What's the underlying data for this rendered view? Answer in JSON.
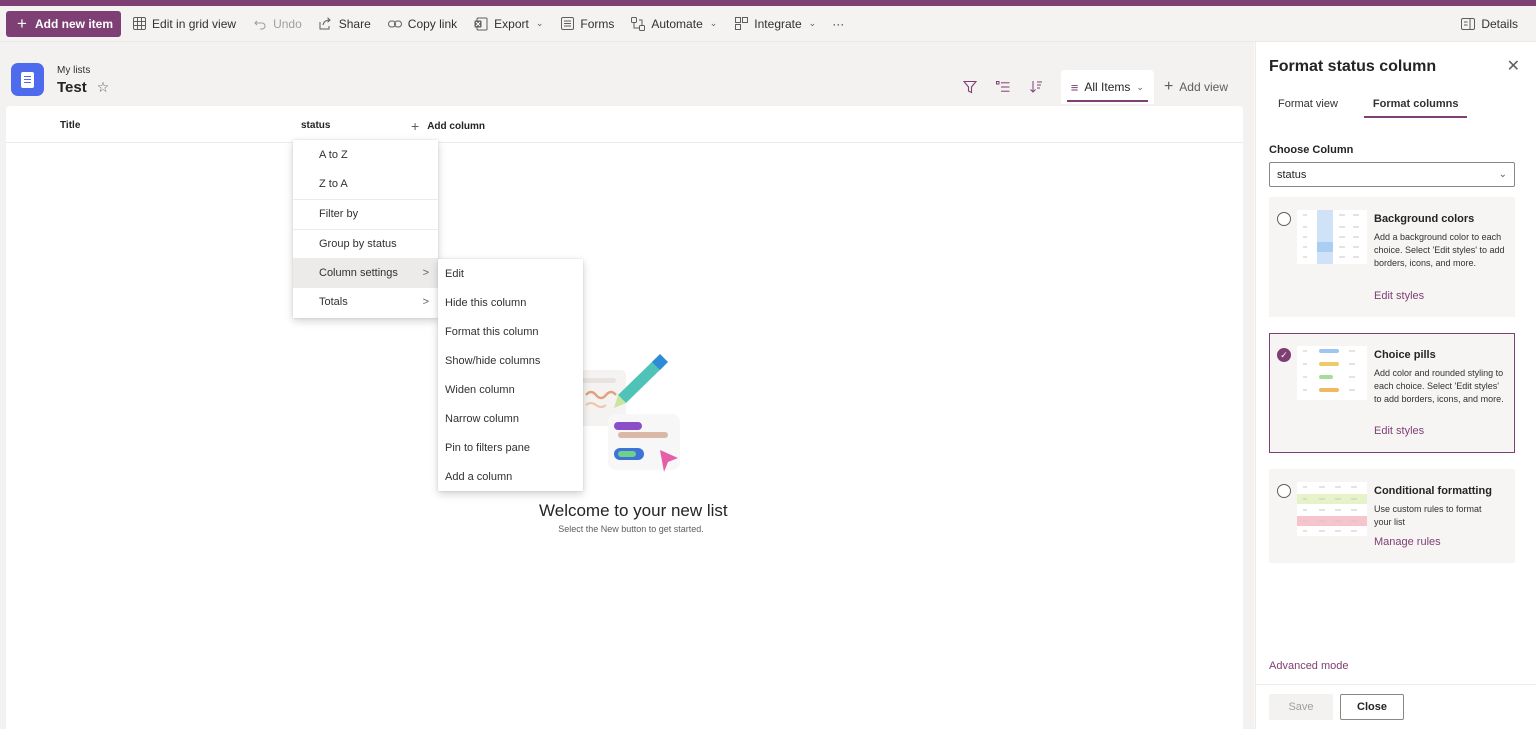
{
  "toolbar": {
    "add_new_item": "Add new item",
    "edit_grid": "Edit in grid view",
    "undo": "Undo",
    "share": "Share",
    "copy_link": "Copy link",
    "export": "Export",
    "forms": "Forms",
    "automate": "Automate",
    "integrate": "Integrate",
    "more": "···",
    "details": "Details"
  },
  "header": {
    "breadcrumb": "My lists",
    "list_title": "Test",
    "star": "☆",
    "view_name": "All Items",
    "add_view": "Add view"
  },
  "columns": {
    "title": "Title",
    "status": "status",
    "add_column": "Add column"
  },
  "empty_state": {
    "title": "Welcome to your new list",
    "subtitle": "Select the New button to get started."
  },
  "column_menu": {
    "items": [
      {
        "label": "A to Z"
      },
      {
        "label": "Z to A"
      },
      {
        "label": "Filter by"
      },
      {
        "label": "Group by status"
      },
      {
        "label": "Column settings",
        "has_submenu": true,
        "active": true
      },
      {
        "label": "Totals",
        "has_submenu": true
      }
    ]
  },
  "settings_submenu": {
    "items": [
      {
        "label": "Edit"
      },
      {
        "label": "Hide this column"
      },
      {
        "label": "Format this column"
      },
      {
        "label": "Show/hide columns"
      },
      {
        "label": "Widen column"
      },
      {
        "label": "Narrow column"
      },
      {
        "label": "Pin to filters pane"
      },
      {
        "label": "Add a column"
      }
    ]
  },
  "panel": {
    "title": "Format status column",
    "tabs": [
      {
        "label": "Format view",
        "active": false
      },
      {
        "label": "Format columns",
        "active": true
      }
    ],
    "choose_column_label": "Choose Column",
    "selected_column": "status",
    "options": [
      {
        "title": "Background colors",
        "desc": "Add a background color to each choice. Select 'Edit styles' to add borders, icons, and more.",
        "link": "Edit styles",
        "selected": false
      },
      {
        "title": "Choice pills",
        "desc": "Add color and rounded styling to each choice. Select 'Edit styles' to add borders, icons, and more.",
        "link": "Edit styles",
        "selected": true
      },
      {
        "title": "Conditional formatting",
        "desc": "Use custom rules to format your list",
        "link": "Manage rules",
        "selected": false
      }
    ],
    "advanced_mode": "Advanced mode",
    "save": "Save",
    "close": "Close"
  },
  "colors": {
    "accent": "#7e3f74",
    "list_icon": "#4f6bed"
  }
}
